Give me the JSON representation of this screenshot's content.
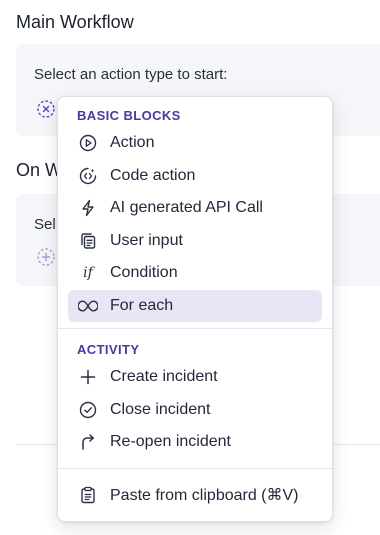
{
  "main_workflow": {
    "title": "Main Workflow",
    "prompt": "Select an action type to start:"
  },
  "on_section": {
    "title_visible": "On W",
    "prompt_visible": "Sel"
  },
  "menu": {
    "basic_blocks_label": "BASIC BLOCKS",
    "basic_blocks": [
      {
        "label": "Action",
        "icon": "play-circle-icon"
      },
      {
        "label": "Code action",
        "icon": "code-circle-icon"
      },
      {
        "label": "AI generated API Call",
        "icon": "lightning-icon"
      },
      {
        "label": "User input",
        "icon": "form-copy-icon"
      },
      {
        "label": "Condition",
        "icon": "if-icon"
      },
      {
        "label": "For each",
        "icon": "loop-icon"
      }
    ],
    "activity_label": "ACTIVITY",
    "activity": [
      {
        "label": "Create incident",
        "icon": "plus-icon"
      },
      {
        "label": "Close incident",
        "icon": "check-circle-icon"
      },
      {
        "label": "Re-open incident",
        "icon": "reopen-arrow-icon"
      }
    ],
    "paste_label": "Paste from clipboard (⌘V)",
    "paste_icon": "clipboard-icon",
    "if_glyph": "if"
  },
  "colors": {
    "accent_purple": "#5b46c4",
    "highlight": "#e8e5f4",
    "card_bg": "#f5f6f9"
  }
}
